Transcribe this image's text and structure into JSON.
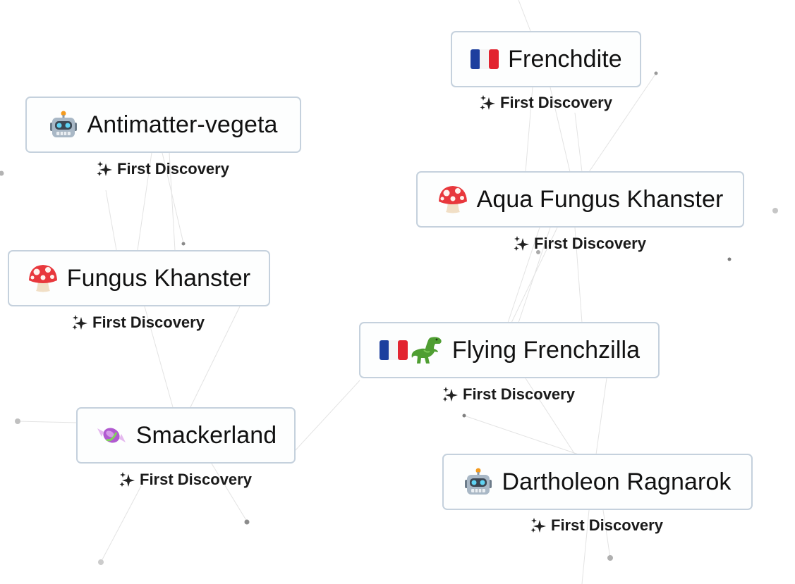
{
  "elements": [
    {
      "key": "frenchdite",
      "name": "Frenchdite",
      "emoji": [
        "france-flag-icon"
      ],
      "badge": "First Discovery"
    },
    {
      "key": "antimatter-vegeta",
      "name": "Antimatter-vegeta",
      "emoji": [
        "robot-icon"
      ],
      "badge": "First Discovery"
    },
    {
      "key": "aqua-fungus-khanster",
      "name": "Aqua Fungus Khanster",
      "emoji": [
        "mushroom-icon"
      ],
      "badge": "First Discovery"
    },
    {
      "key": "fungus-khanster",
      "name": "Fungus Khanster",
      "emoji": [
        "mushroom-icon"
      ],
      "badge": "First Discovery"
    },
    {
      "key": "flying-frenchzilla",
      "name": "Flying Frenchzilla",
      "emoji": [
        "france-flag-icon",
        "t-rex-icon"
      ],
      "badge": "First Discovery"
    },
    {
      "key": "smackerland",
      "name": "Smackerland",
      "emoji": [
        "candy-icon"
      ],
      "badge": "First Discovery"
    },
    {
      "key": "dartholeon-ragnarok",
      "name": "Dartholeon Ragnarok",
      "emoji": [
        "robot-icon"
      ],
      "badge": "First Discovery"
    }
  ],
  "colors": {
    "tile_border": "#c5d1dd",
    "tile_background": "#fdfefe",
    "text": "#111111",
    "line": "#e2e2e2",
    "dot": "#9a9a9a"
  }
}
